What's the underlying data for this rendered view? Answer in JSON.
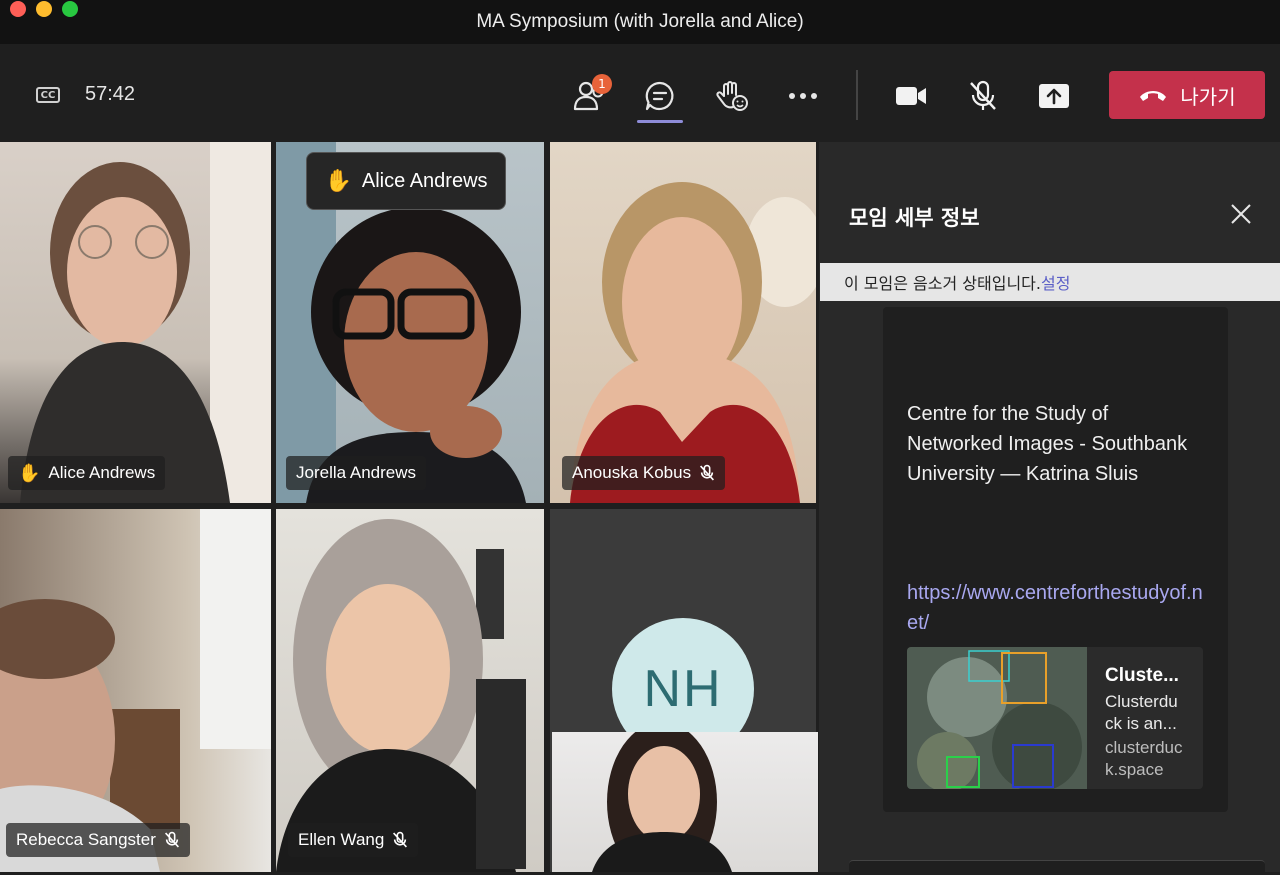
{
  "window": {
    "title": "MA Symposium (with Jorella and Alice)"
  },
  "toolbar": {
    "cc_label": "CC",
    "timer": "57:42",
    "participants_badge": "1",
    "leave_label": "나가기",
    "icons": [
      "people-icon",
      "chat-icon",
      "raise-hand-icon",
      "more-icon",
      "camera-icon",
      "mic-off-icon",
      "share-icon",
      "phone-hangup-icon"
    ]
  },
  "raised_hand_banner": {
    "name": "Alice Andrews"
  },
  "participants": [
    {
      "name": "Alice Andrews",
      "hand_raised": true,
      "muted": false
    },
    {
      "name": "Jorella Andrews",
      "hand_raised": false,
      "muted": false
    },
    {
      "name": "Anouska Kobus",
      "hand_raised": false,
      "muted": true
    },
    {
      "name": "Rebecca Sangster",
      "hand_raised": false,
      "muted": true
    },
    {
      "name": "Ellen Wang",
      "hand_raised": false,
      "muted": true
    },
    {
      "initials": "NH"
    }
  ],
  "panel": {
    "title": "모임 세부 정보",
    "mute_notice": "이 모임은 음소거 상태입니다.",
    "mute_notice_link": "설정",
    "card_text": "Centre for the Study of Networked Images - Southbank University — Katrina Sluis",
    "card_link": "https://www.centreforthestudyof.net/",
    "preview": {
      "title": "Cluste...",
      "description": "Clusterduck is an...",
      "site": "clusterduck.space"
    }
  },
  "colors": {
    "leave": "#c4314b",
    "badge": "#e8633a",
    "accent": "#8e8cd8",
    "link": "#a9a8f0",
    "avatar_bg": "#cfe9ea"
  }
}
